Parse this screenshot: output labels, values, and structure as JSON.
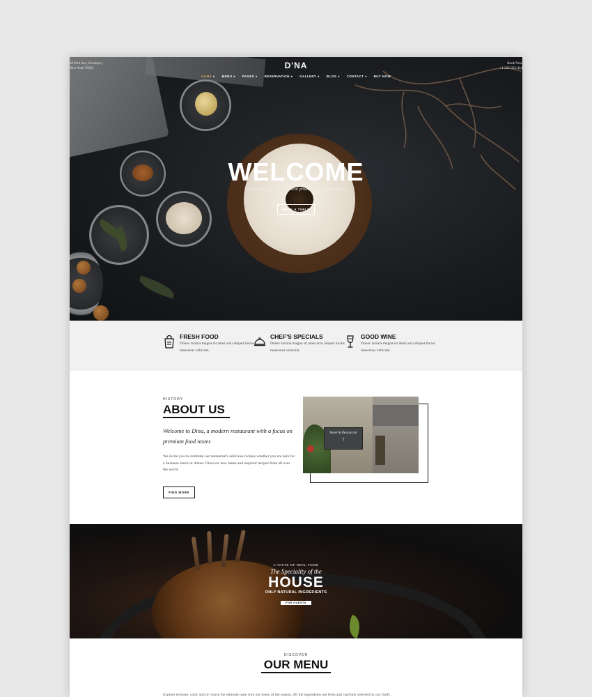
{
  "header": {
    "address": "40 Park Ave, Brooklyn,\nNew York 70250",
    "book_label": "Book Now",
    "phone": "+1-222-333-444",
    "logo": "D'NA",
    "nav": [
      "HOME",
      "MENU",
      "PAGES",
      "RESERVATION",
      "GALLERY",
      "BLOG",
      "CONTACT",
      "BUY NOW"
    ]
  },
  "hero": {
    "title": "WELCOME",
    "tagline": "Traditional cuisine with local products of highest quality",
    "button": "BOOK A TABLE"
  },
  "features": [
    {
      "icon": "grocery-bag-icon",
      "title": "FRESH FOOD",
      "text": "Donec lacinia magna sit amet arcu aliquet luctus maecenas vehicula."
    },
    {
      "icon": "cloche-icon",
      "title": "CHEF'S SPECIALS",
      "text": "Donec lacinia magna sit amet arcu aliquet luctus maecenas vehicula."
    },
    {
      "icon": "wine-glass-icon",
      "title": "GOOD WINE",
      "text": "Donec lacinia magna sit amet arcu aliquet luctus maecenas vehicula."
    }
  ],
  "about": {
    "eyebrow": "HISTORY",
    "title": "ABOUT US",
    "lead": "Welcome to Dina, a modern restaurant with a focus on premium food tastes",
    "body": "We invite you to celebrate our restaurant's delicious recipes whether you are here for a business lunch or dinner. Discover new tastes and inspired recipes from all over the world.",
    "button": "FIND MORE",
    "sign_text": "Hotel & Restaurant"
  },
  "special": {
    "line1": "A TASTE OF REAL FOOD",
    "line2": "The Speciality of the",
    "line3": "HOUSE",
    "line4": "ONLY NATURAL INGREDIENTS",
    "line5": "FOR GUESTS"
  },
  "menu": {
    "eyebrow": "DISCOVER",
    "title": "OUR MENU",
    "intro": "Explore textures, color and of course the ultimate taste with our menu of the season. All the ingredients are fresh and carefully selected by our chefs."
  },
  "colors": {
    "accent": "#c9a55b",
    "dark": "#111111",
    "feature_band": "#f1f1f1"
  }
}
